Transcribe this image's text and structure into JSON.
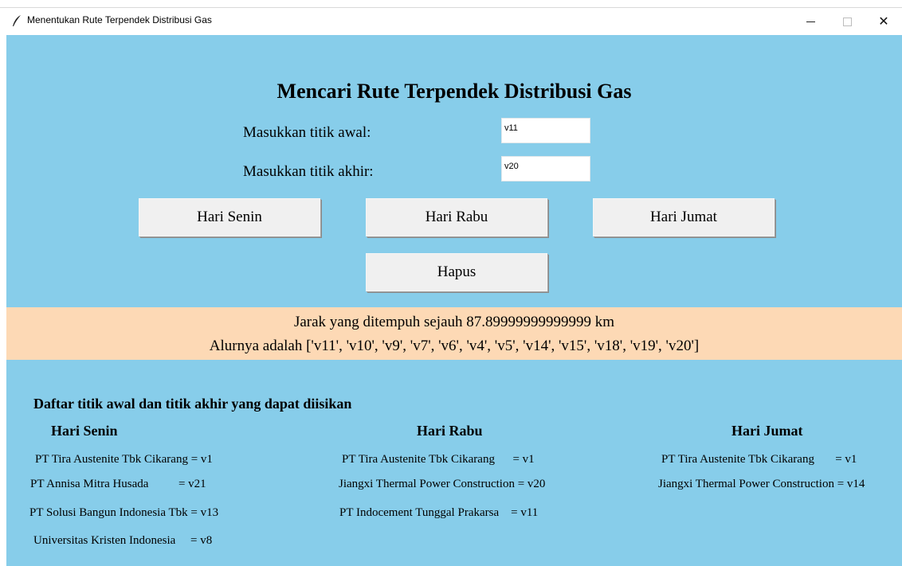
{
  "window": {
    "title": "Menentukan Rute Terpendek Distribusi Gas",
    "min_glyph": "",
    "close_glyph": "✕"
  },
  "form": {
    "heading": "Mencari Rute Terpendek Distribusi Gas",
    "start_label": "Masukkan titik awal:",
    "start_value": "v11",
    "end_label": "Masukkan titik akhir:",
    "end_value": "v20"
  },
  "buttons": {
    "senin": "Hari Senin",
    "rabu": "Hari Rabu",
    "jumat": "Hari Jumat",
    "hapus": "Hapus"
  },
  "result": {
    "distance": "Jarak yang ditempuh sejauh 87.89999999999999 km",
    "route": "Alurnya adalah ['v11', 'v10', 'v9', 'v7', 'v6', 'v4', 'v5', 'v14', 'v15', 'v18', 'v19', 'v20']"
  },
  "list": {
    "title": "Daftar titik awal dan titik akhir yang dapat diisikan",
    "senin": {
      "title": "Hari Senin",
      "items": [
        "PT Tira Austenite Tbk Cikarang = v1",
        "PT Annisa Mitra Husada          = v21",
        "PT Solusi Bangun Indonesia Tbk = v13",
        "Universitas Kristen Indonesia     = v8"
      ]
    },
    "rabu": {
      "title": "Hari Rabu",
      "items": [
        "PT Tira Austenite Tbk Cikarang      = v1",
        "Jiangxi Thermal Power Construction = v20",
        "PT Indocement Tunggal Prakarsa    = v11"
      ]
    },
    "jumat": {
      "title": "Hari Jumat",
      "items": [
        "PT Tira Austenite Tbk Cikarang       = v1",
        "Jiangxi Thermal Power Construction = v14"
      ]
    }
  }
}
